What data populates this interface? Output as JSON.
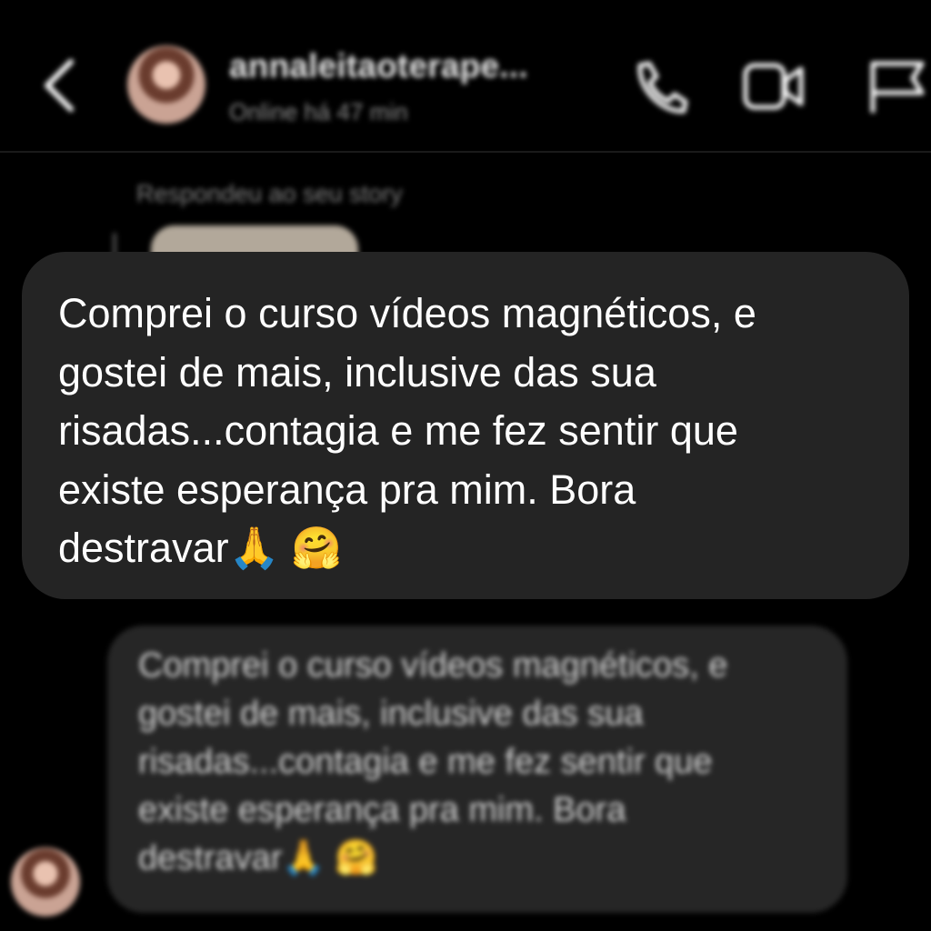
{
  "header": {
    "contact_name": "annaleitaoterape...",
    "status": "Online há 47 min",
    "icons": [
      "back-chevron-icon",
      "phone-icon",
      "video-camera-icon",
      "flag-icon"
    ]
  },
  "thread": {
    "replied_label": "Respondeu ao seu story"
  },
  "message": {
    "text": "Comprei o curso vídeos magnéticos, e\ngostei de mais, inclusive das sua\nrisadas...contagia e me fez sentir que\nexiste esperança pra mim. Bora\ndestravar🙏 🤗"
  },
  "background_message": {
    "text": "Comprei o curso vídeos magnéticos, e\ngostei de mais, inclusive das sua\nrisadas...contagia e me fez sentir que\nexiste esperança pra mim. Bora\ndestravar🙏 🤗"
  },
  "colors": {
    "background": "#000000",
    "bubble": "#242424",
    "text": "#ffffff",
    "muted": "#8d8d8d"
  }
}
